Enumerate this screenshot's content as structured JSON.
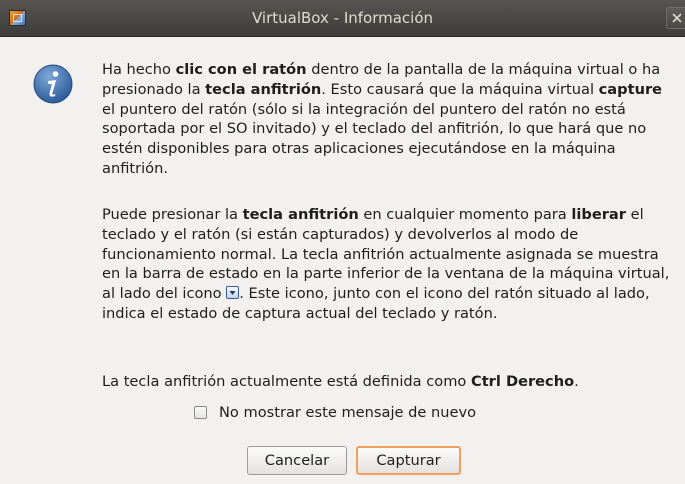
{
  "window": {
    "title": "VirtualBox - Información",
    "app_icon": "virtualbox-icon",
    "close_icon": "close-icon"
  },
  "message": {
    "icon": "info-icon",
    "p1": {
      "t1": "Ha hecho ",
      "b1": "clic con el ratón",
      "t2": " dentro de la pantalla de la máquina virtual o ha presionado la ",
      "b2": "tecla anfitrión",
      "t3": ". Esto causará que la máquina virtual ",
      "b3": "capture",
      "t4": " el puntero del ratón (sólo si la integración del puntero del ratón no está soportada por el SO invitado) y el teclado del anfitrión, lo que hará que no estén disponibles para otras aplicaciones ejecutándose en la máquina anfitrión."
    },
    "p2": {
      "t1": "Puede presionar la ",
      "b1": "tecla anfitrión",
      "t2": " en cualquier momento para ",
      "b2": "liberar",
      "t3": " el teclado y el ratón (si están capturados) y devolverlos al modo de funcionamiento normal. La tecla anfitrión actualmente asignada se muestra en la barra de estado en la parte inferior de la ventana de la máquina virtual, al lado del icono ",
      "t4": ". Este icono, junto con el icono del ratón situado al lado, indica el estado de captura actual del teclado y ratón."
    },
    "p3": {
      "t1": "La tecla anfitrión actualmente está definida como ",
      "b1": "Ctrl Derecho",
      "t2": "."
    }
  },
  "checkbox": {
    "label": "No mostrar este mensaje de nuevo",
    "checked": false
  },
  "buttons": {
    "cancel": "Cancelar",
    "capture": "Capturar"
  },
  "colors": {
    "titlebar": "#4a4945",
    "background": "#f2f1f0",
    "default_button_border": "#f0a05c"
  }
}
